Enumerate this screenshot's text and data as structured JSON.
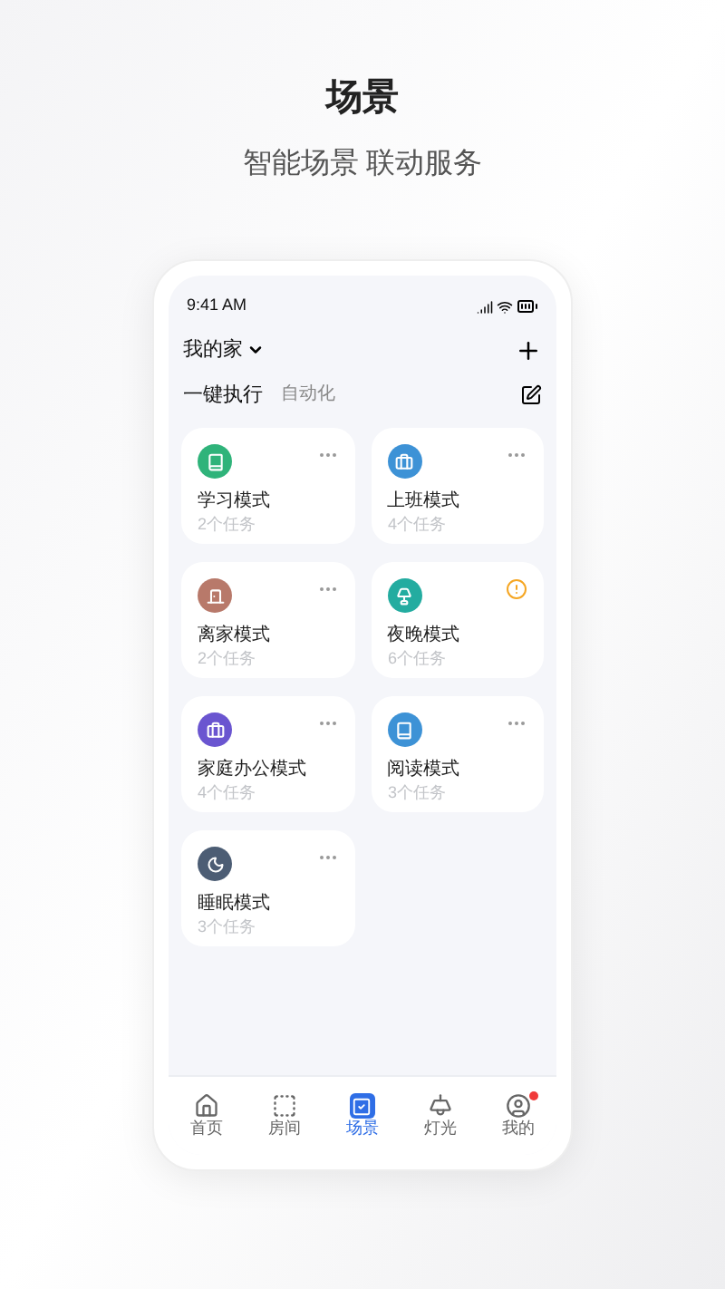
{
  "page": {
    "title": "场景",
    "subtitle": "智能场景 联动服务"
  },
  "status_bar": {
    "time": "9:41 AM"
  },
  "header": {
    "home": "我的家"
  },
  "tabs": [
    {
      "label": "一键执行",
      "selected": true
    },
    {
      "label": "自动化",
      "selected": false
    }
  ],
  "scenes": [
    {
      "name": "学习模式",
      "tasks": "2个任务",
      "color": "#2fb37a",
      "kind": "book",
      "warning": false
    },
    {
      "name": "上班模式",
      "tasks": "4个任务",
      "color": "#3d92d6",
      "kind": "briefcase",
      "warning": false
    },
    {
      "name": "离家模式",
      "tasks": "2个任务",
      "color": "#b8796a",
      "kind": "door",
      "warning": false
    },
    {
      "name": "夜晚模式",
      "tasks": "6个任务",
      "color": "#23aca0",
      "kind": "lamp",
      "warning": true
    },
    {
      "name": "家庭办公模式",
      "tasks": "4个任务",
      "color": "#6a55d0",
      "kind": "briefcase",
      "warning": false
    },
    {
      "name": "阅读模式",
      "tasks": "3个任务",
      "color": "#3d92d6",
      "kind": "book",
      "warning": false
    },
    {
      "name": "睡眠模式",
      "tasks": "3个任务",
      "color": "#4c5d74",
      "kind": "moon",
      "warning": false
    }
  ],
  "nav": [
    {
      "label": "首页",
      "kind": "home",
      "selected": false,
      "badge": false
    },
    {
      "label": "房间",
      "kind": "room",
      "selected": false,
      "badge": false
    },
    {
      "label": "场景",
      "kind": "scene",
      "selected": true,
      "badge": false
    },
    {
      "label": "灯光",
      "kind": "light",
      "selected": false,
      "badge": false
    },
    {
      "label": "我的",
      "kind": "user",
      "selected": false,
      "badge": true
    }
  ]
}
